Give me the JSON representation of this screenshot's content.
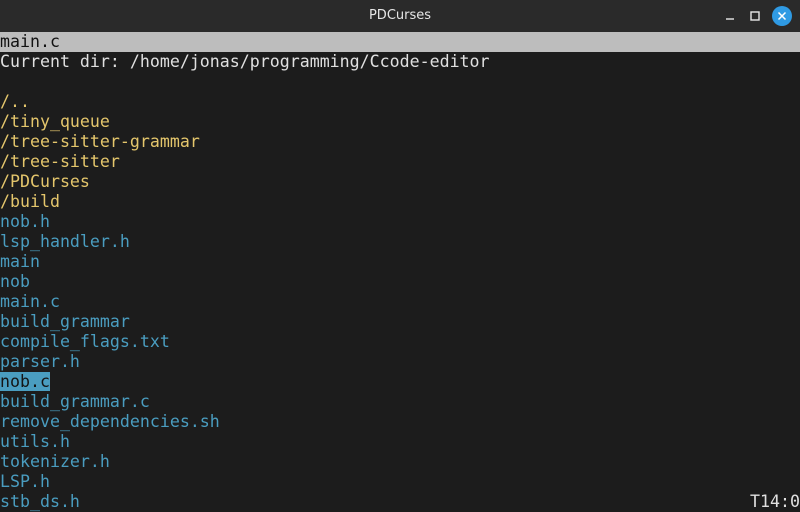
{
  "window": {
    "title": "PDCurses",
    "min_icon": "minimize-icon",
    "max_icon": "maximize-icon",
    "close_icon": "close-icon"
  },
  "terminal": {
    "header": "main.c",
    "current_dir": "Current dir: /home/jonas/programming/Ccode-editor",
    "entries": [
      {
        "name": "/..",
        "kind": "dir"
      },
      {
        "name": "/tiny_queue",
        "kind": "dir"
      },
      {
        "name": "/tree-sitter-grammar",
        "kind": "dir"
      },
      {
        "name": "/tree-sitter",
        "kind": "dir"
      },
      {
        "name": "/PDCurses",
        "kind": "dir"
      },
      {
        "name": "/build",
        "kind": "dir"
      },
      {
        "name": "nob.h",
        "kind": "file"
      },
      {
        "name": "lsp_handler.h",
        "kind": "file"
      },
      {
        "name": "main",
        "kind": "file"
      },
      {
        "name": "nob",
        "kind": "file"
      },
      {
        "name": "main.c",
        "kind": "file"
      },
      {
        "name": "build_grammar",
        "kind": "file"
      },
      {
        "name": "compile_flags.txt",
        "kind": "file"
      },
      {
        "name": "parser.h",
        "kind": "file"
      },
      {
        "name": "nob.c",
        "kind": "file",
        "selected": true
      },
      {
        "name": "build_grammar.c",
        "kind": "file"
      },
      {
        "name": "remove_dependencies.sh",
        "kind": "file"
      },
      {
        "name": "utils.h",
        "kind": "file"
      },
      {
        "name": "tokenizer.h",
        "kind": "file"
      },
      {
        "name": "LSP.h",
        "kind": "file"
      },
      {
        "name": "stb_ds.h",
        "kind": "file"
      }
    ],
    "status": "T14:0"
  },
  "colors": {
    "background": "#1c1c1c",
    "header_bar": "#bdbdbd",
    "directory": "#e4c66c",
    "file": "#4a9dc0",
    "selection": "#4a9dc0",
    "close_button": "#2f9ae3"
  }
}
